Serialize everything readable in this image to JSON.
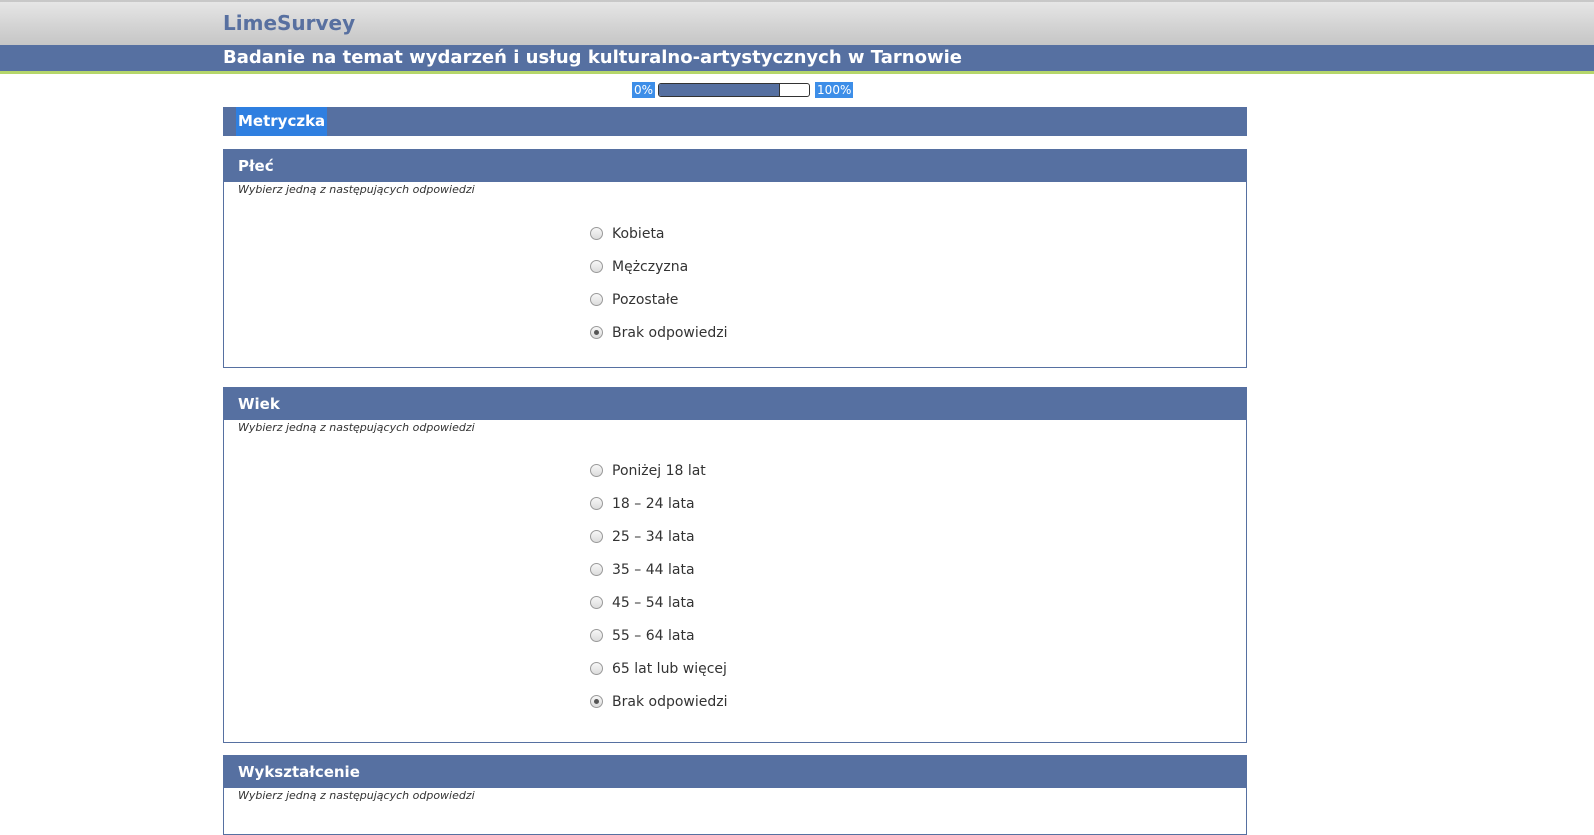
{
  "app": {
    "logo": "LimeSurvey",
    "survey_title": "Badanie na temat wydarzeń i usług kulturalno-artystycznych w Tarnowie"
  },
  "progress": {
    "start_label": "0%",
    "end_label": "100%",
    "value": 0.8
  },
  "group": {
    "name": "Metryczka"
  },
  "questions": [
    {
      "title": "Płeć",
      "help": "Wybierz jedną z następujących odpowiedzi",
      "answers": [
        {
          "label": "Kobieta",
          "checked": false
        },
        {
          "label": "Mężczyzna",
          "checked": false
        },
        {
          "label": "Pozostałe",
          "checked": false
        },
        {
          "label": "Brak odpowiedzi",
          "checked": true
        }
      ]
    },
    {
      "title": "Wiek",
      "help": "Wybierz jedną z następujących odpowiedzi",
      "answers": [
        {
          "label": "Poniżej 18 lat",
          "checked": false
        },
        {
          "label": "18 – 24 lata",
          "checked": false
        },
        {
          "label": "25 – 34 lata",
          "checked": false
        },
        {
          "label": "35 – 44 lata",
          "checked": false
        },
        {
          "label": "45 – 54 lata",
          "checked": false
        },
        {
          "label": "55 – 64 lata",
          "checked": false
        },
        {
          "label": "65 lat lub więcej",
          "checked": false
        },
        {
          "label": "Brak odpowiedzi",
          "checked": true
        }
      ]
    },
    {
      "title": "Wykształcenie",
      "help": "Wybierz jedną z następujących odpowiedzi",
      "answers": []
    }
  ]
}
